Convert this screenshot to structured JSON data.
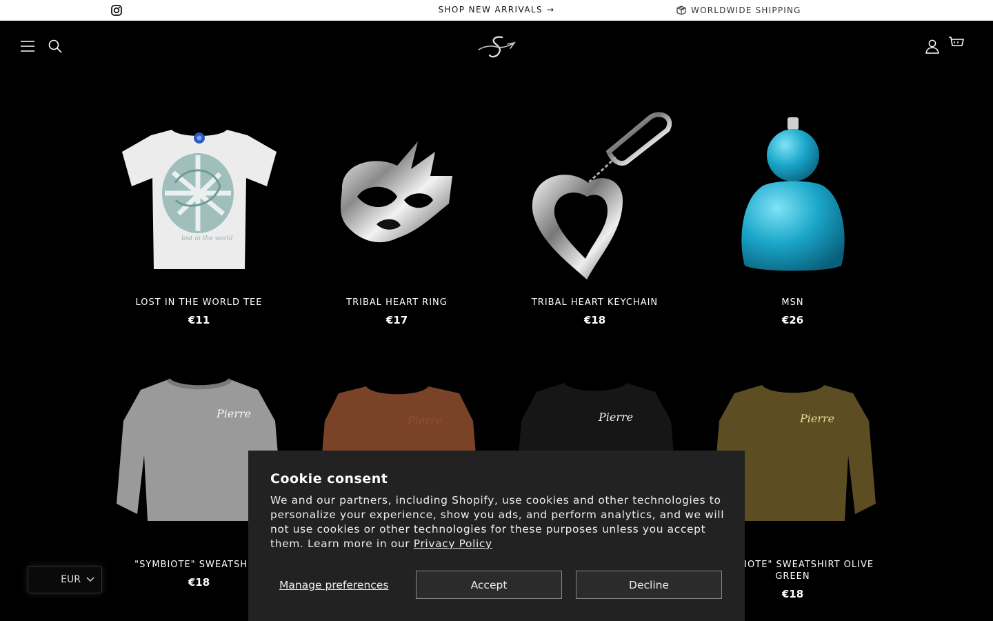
{
  "announcement": {
    "center_text": "SHOP NEW ARRIVALS",
    "right_text": "WORLDWIDE SHIPPING"
  },
  "header": {
    "icons": [
      "menu-icon",
      "search-icon",
      "logo",
      "account-icon",
      "cart-icon"
    ]
  },
  "products": [
    {
      "name": "LOST IN THE WORLD TEE",
      "price": "€11"
    },
    {
      "name": "TRIBAL HEART RING",
      "price": "€17"
    },
    {
      "name": "TRIBAL HEART KEYCHAIN",
      "price": "€18"
    },
    {
      "name": "MSN",
      "price": "€26"
    },
    {
      "name": "\"SYMBIOTE\" SWEATSHIRT",
      "price": "€18"
    },
    {
      "name": "",
      "price": ""
    },
    {
      "name": "",
      "price": ""
    },
    {
      "name": "\"SYMBIOTE\" SWEATSHIRT OLIVE GREEN",
      "price": "€18"
    }
  ],
  "currency": {
    "value": "EUR"
  },
  "cookie": {
    "title": "Cookie consent",
    "body": "We and our partners, including Shopify, use cookies and other technologies to personalize your experience, show you ads, and perform analytics, and we will not use cookies or other technologies for these purposes unless you accept them. Learn more in our ",
    "link": "Privacy Policy",
    "manage": "Manage preferences",
    "accept": "Accept",
    "decline": "Decline"
  },
  "colors": {
    "background": "#000000",
    "modal": "#222222",
    "tee_print": "#8fb3b0",
    "msn_blue": "#1aa6c9",
    "sweat_grey": "#9a9a9a",
    "sweat_brown": "#7a4327",
    "sweat_black": "#161616",
    "sweat_olive": "#5c4e22"
  }
}
